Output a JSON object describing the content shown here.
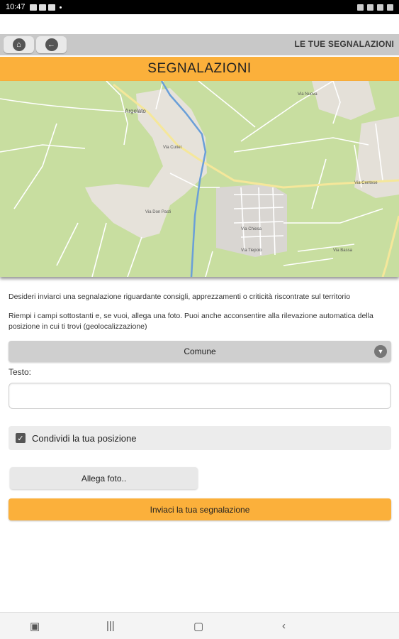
{
  "status": {
    "time": "10:47"
  },
  "header": {
    "section_label": "LE TUE SEGNALAZIONI",
    "title": "SEGNALAZIONI"
  },
  "map": {
    "labels": [
      "Argelato",
      "Via Centese",
      "Via Curiel",
      "Via Don Pasti",
      "Via Chiesa",
      "Via Nuova",
      "Via Tiepolo",
      "Via Bassa"
    ]
  },
  "form": {
    "intro": "Desideri inviarci una segnalazione riguardante consigli, apprezzamenti o criticità riscontrate sul territorio",
    "instructions": "Riempi i campi sottostanti e, se vuoi, allega una foto. Puoi anche acconsentire alla rilevazione automatica della posizione in cui ti trovi (geolocalizzazione)",
    "comune_select": "Comune",
    "text_label": "Testo:",
    "text_value": "",
    "share_position_label": "Condividi la tua posizione",
    "share_position_checked": true,
    "attach_photo": "Allega foto..",
    "submit": "Inviaci la tua segnalazione"
  },
  "colors": {
    "accent": "#fbb03b",
    "toolbar": "#c8c8c8"
  }
}
